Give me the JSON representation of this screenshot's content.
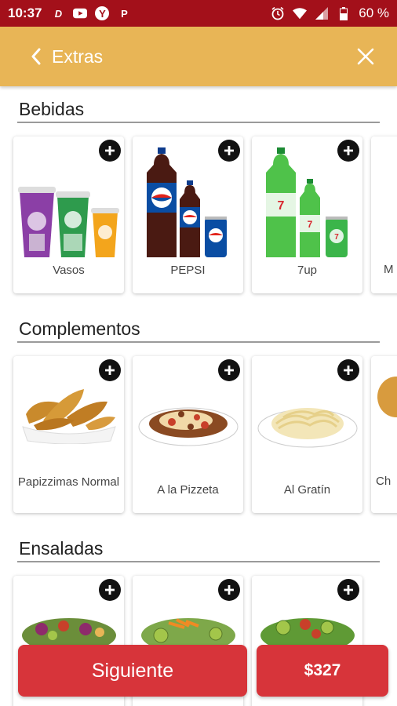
{
  "status_bar": {
    "time": "10:37",
    "battery": "60 %",
    "app_icons": [
      "D",
      "Y",
      "P"
    ]
  },
  "app_bar": {
    "title": "Extras",
    "back_icon": "chevron-left-icon",
    "close_icon": "close-icon"
  },
  "sections": [
    {
      "title": "Bebidas",
      "items": [
        {
          "label": "Vasos",
          "image": "cups-image"
        },
        {
          "label": "PEPSI",
          "image": "pepsi-bottles-image"
        },
        {
          "label": "7up",
          "image": "7up-bottles-image"
        }
      ],
      "peek_label": "M"
    },
    {
      "title": "Complementos",
      "items": [
        {
          "label": "Papizzimas Normal",
          "image": "potato-wedges-image"
        },
        {
          "label": "A la Pizzeta",
          "image": "pasta-pizzeta-image"
        },
        {
          "label": "Al Gratín",
          "image": "pasta-gratin-image"
        }
      ],
      "peek_label": "Ch"
    },
    {
      "title": "Ensaladas",
      "items": [
        {
          "label": "",
          "image": "salad-1-image"
        },
        {
          "label": "",
          "image": "salad-2-image"
        },
        {
          "label": "",
          "image": "salad-3-image"
        }
      ]
    }
  ],
  "bottom": {
    "next_label": "Siguiente",
    "total": "$327"
  },
  "colors": {
    "status_bar": "#a3101a",
    "app_bar": "#e8b556",
    "button": "#d7343a"
  }
}
